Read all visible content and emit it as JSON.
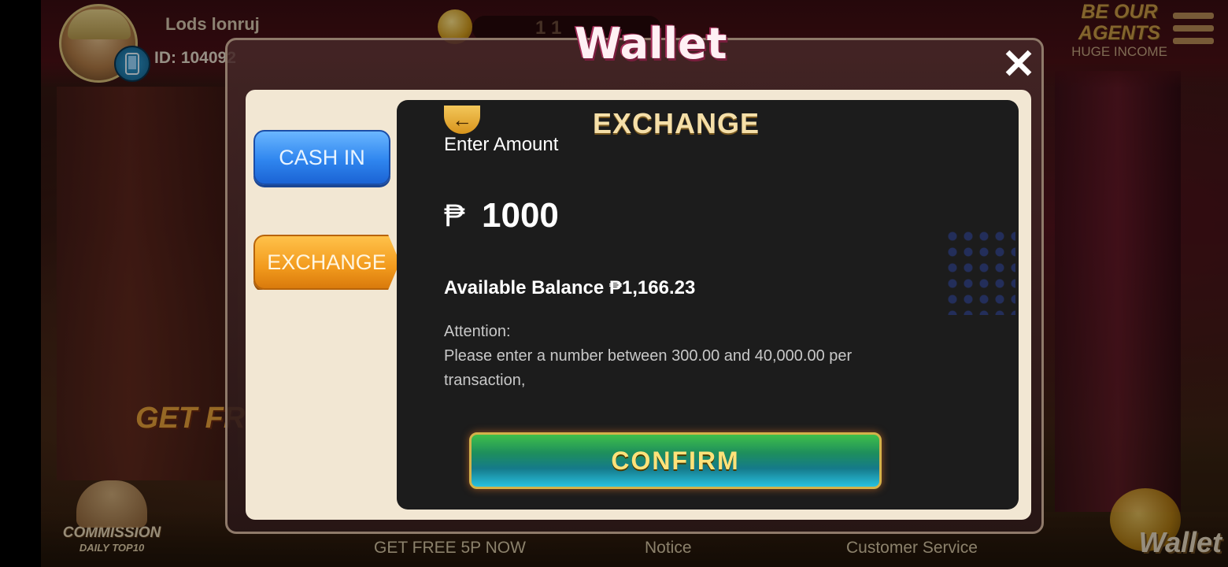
{
  "header": {
    "username": "Lods lonruj",
    "user_id": "ID: 104092",
    "balance_partial": "1 1",
    "agents_line1": "BE OUR",
    "agents_line2": "AGENTS",
    "agents_sub": "HUGE INCOME"
  },
  "background": {
    "get_free_banner": "GET FR",
    "commission_title": "COMMISSION",
    "commission_sub": "DAILY TOP10",
    "wallet_corner": "Wallet"
  },
  "bottom_nav": {
    "get_free": "GET FREE 5P NOW",
    "notice": "Notice",
    "customer_service": "Customer Service"
  },
  "modal": {
    "title": "Wallet",
    "close_symbol": "✕",
    "tabs": [
      {
        "label": "CASH IN",
        "active": false
      },
      {
        "label": "EXCHANGE",
        "active": true
      }
    ],
    "exchange": {
      "title": "EXCHANGE",
      "back_symbol": "←",
      "enter_amount_label": "Enter Amount",
      "currency_symbol": "₱",
      "amount_value": "1000",
      "available_balance": "Available Balance ₱1,166.23",
      "attention_label": "Attention:",
      "attention_text": "Please enter a number between 300.00 and 40,000.00 per transaction,",
      "confirm_label": "CONFIRM"
    }
  },
  "colors": {
    "cash_in_tab": "#2f86ef",
    "exchange_tab": "#f29a1d",
    "content_bg": "#1c1c1c",
    "panel_bg": "#f2e7d3",
    "confirm_text": "#ffe27a"
  }
}
